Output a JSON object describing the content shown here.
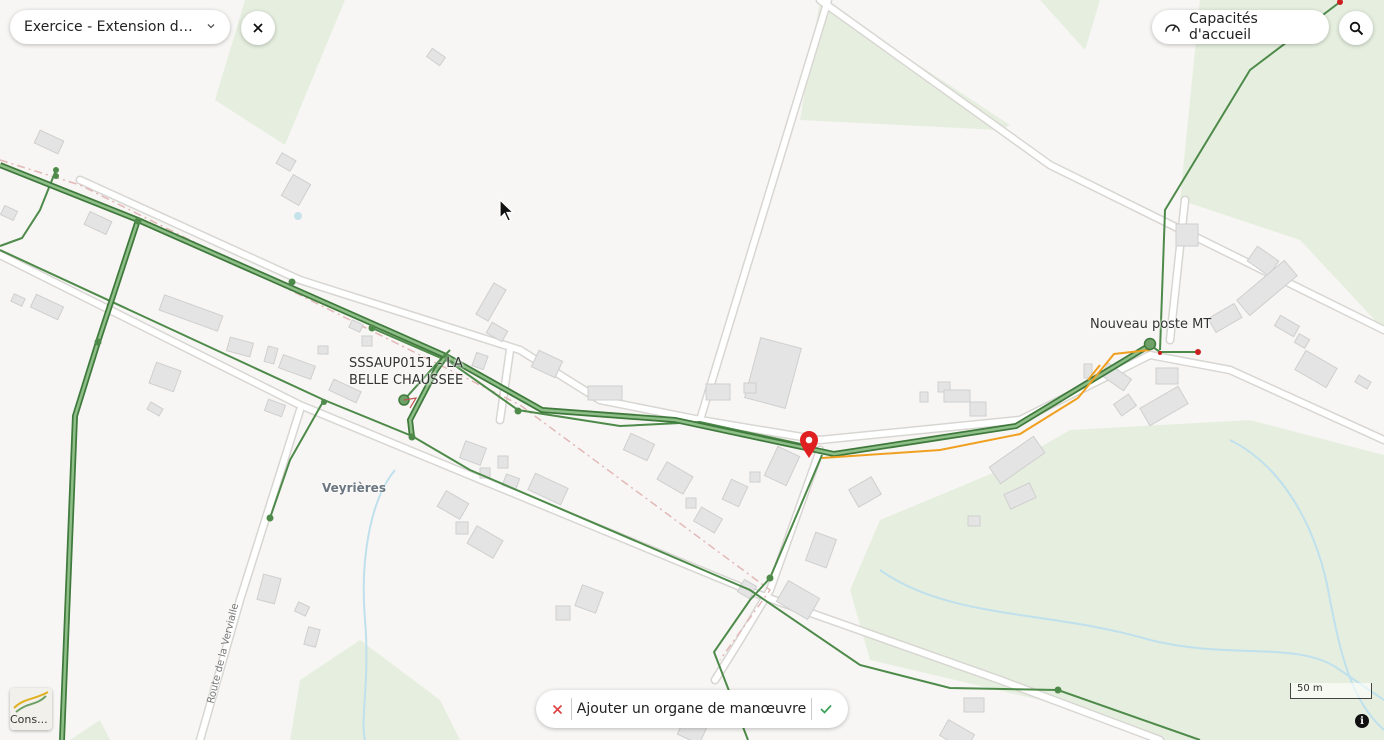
{
  "header": {
    "exercise_label": "Exercice - Extension de ré…",
    "capacity_label": "Capacités d'accueil"
  },
  "map": {
    "labels": {
      "substation": "SSSAUP0151 - LA\nBELLE CHAUSSEE",
      "substation_line1": "SSSAUP0151 - LA",
      "substation_line2": "BELLE CHAUSSEE",
      "new_post": "Nouveau poste MT",
      "village": "Veyrières",
      "road": "Route de la Vervialle"
    },
    "scale_label": "50 m",
    "layer_tile_label": "Cons..."
  },
  "action_bar": {
    "label": "Ajouter un organe de manœuvre"
  },
  "icons": {
    "exercise_chevron": "chevron-down-icon",
    "close": "close-icon",
    "capacity": "gauge-icon",
    "search": "search-icon",
    "cancel": "cancel-icon",
    "confirm": "check-icon",
    "info": "info-icon",
    "marker": "map-pin-icon"
  },
  "colors": {
    "network_green": "#4e8a4a",
    "proposed_orange": "#f0a020",
    "marker_red": "#e02020",
    "woodland": "#e6efdf",
    "cancel_red": "#e04040",
    "confirm_green": "#3aa055"
  }
}
